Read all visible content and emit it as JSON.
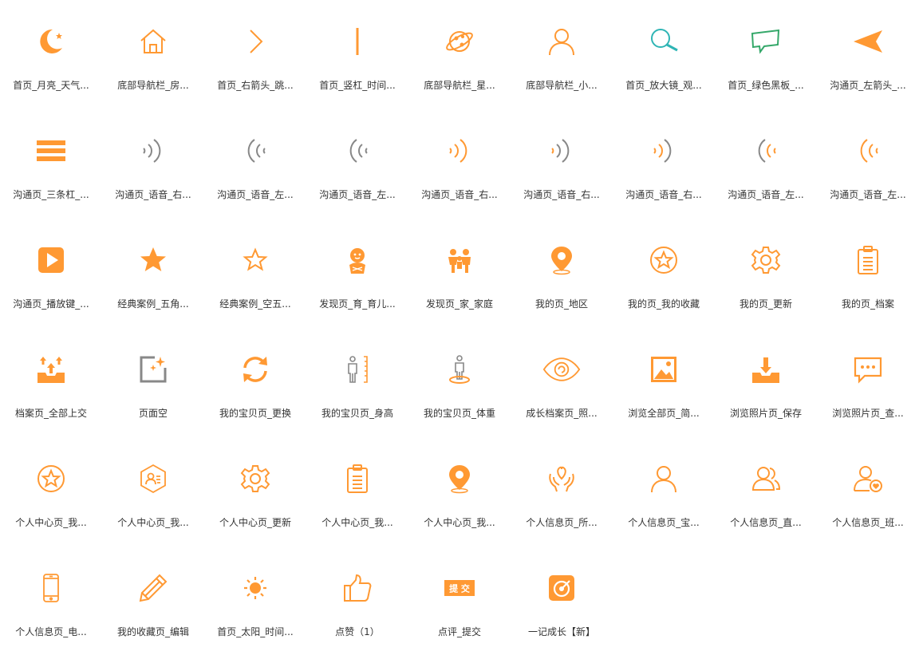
{
  "colors": {
    "orange": "#ff9933",
    "teal": "#2fb5b5",
    "green": "#35a86a",
    "gray": "#888888",
    "text": "#333333"
  },
  "icons": [
    {
      "label": "首页_月亮_天气...",
      "icon": "moon-icon"
    },
    {
      "label": "底部导航栏_房...",
      "icon": "house-icon"
    },
    {
      "label": "首页_右箭头_跳...",
      "icon": "chevron-right-icon"
    },
    {
      "label": "首页_竖杠_时间...",
      "icon": "vertical-bar-icon"
    },
    {
      "label": "底部导航栏_星...",
      "icon": "planet-icon"
    },
    {
      "label": "底部导航栏_小...",
      "icon": "person-outline-icon"
    },
    {
      "label": "首页_放大镜_观...",
      "icon": "magnifier-icon"
    },
    {
      "label": "首页_绿色黑板_...",
      "icon": "green-board-icon"
    },
    {
      "label": "沟通页_左箭头_...",
      "icon": "left-arrow-icon"
    },
    {
      "label": "沟通页_三条杠_...",
      "icon": "three-bars-icon"
    },
    {
      "label": "沟通页_语音_右...",
      "icon": "voice-right-gray-icon"
    },
    {
      "label": "沟通页_语音_左...",
      "icon": "voice-left-gray-icon"
    },
    {
      "label": "沟通页_语音_左...",
      "icon": "voice-left-gray-icon"
    },
    {
      "label": "沟通页_语音_右...",
      "icon": "voice-right-orange-icon"
    },
    {
      "label": "沟通页_语音_右...",
      "icon": "voice-right-mixed-icon"
    },
    {
      "label": "沟通页_语音_右...",
      "icon": "voice-right-mixed-icon"
    },
    {
      "label": "沟通页_语音_左...",
      "icon": "voice-left-mixed-icon"
    },
    {
      "label": "沟通页_语音_左...",
      "icon": "voice-left-orange-icon"
    },
    {
      "label": "沟通页_播放键_...",
      "icon": "play-button-icon"
    },
    {
      "label": "经典案例_五角...",
      "icon": "star-filled-icon"
    },
    {
      "label": "经典案例_空五...",
      "icon": "star-outline-icon"
    },
    {
      "label": "发现页_育_育儿...",
      "icon": "baby-icon"
    },
    {
      "label": "发现页_家_家庭",
      "icon": "family-icon"
    },
    {
      "label": "我的页_地区",
      "icon": "location-pin-icon"
    },
    {
      "label": "我的页_我的收藏",
      "icon": "star-circle-icon"
    },
    {
      "label": "我的页_更新",
      "icon": "gear-icon"
    },
    {
      "label": "我的页_档案",
      "icon": "clipboard-icon"
    },
    {
      "label": "档案页_全部上交",
      "icon": "upload-tray-icon"
    },
    {
      "label": "页面空",
      "icon": "empty-page-icon"
    },
    {
      "label": "我的宝贝页_更换",
      "icon": "refresh-icon"
    },
    {
      "label": "我的宝贝页_身高",
      "icon": "height-icon"
    },
    {
      "label": "我的宝贝页_体重",
      "icon": "weight-icon"
    },
    {
      "label": "成长档案页_照...",
      "icon": "eye-icon"
    },
    {
      "label": "浏览全部页_简...",
      "icon": "image-icon"
    },
    {
      "label": "浏览照片页_保存",
      "icon": "download-tray-icon"
    },
    {
      "label": "浏览照片页_查...",
      "icon": "chat-bubble-icon"
    },
    {
      "label": "个人中心页_我...",
      "icon": "star-circle-icon"
    },
    {
      "label": "个人中心页_我...",
      "icon": "hexagon-user-icon"
    },
    {
      "label": "个人中心页_更新",
      "icon": "gear-icon"
    },
    {
      "label": "个人中心页_我...",
      "icon": "clipboard-icon"
    },
    {
      "label": "个人中心页_我...",
      "icon": "location-pin-icon"
    },
    {
      "label": "个人信息页_所...",
      "icon": "hands-heart-icon"
    },
    {
      "label": "个人信息页_宝...",
      "icon": "person-outline-icon"
    },
    {
      "label": "个人信息页_直...",
      "icon": "two-persons-icon"
    },
    {
      "label": "个人信息页_班...",
      "icon": "person-heart-icon"
    },
    {
      "label": "个人信息页_电...",
      "icon": "phone-icon"
    },
    {
      "label": "我的收藏页_编辑",
      "icon": "pencil-icon"
    },
    {
      "label": "首页_太阳_时间...",
      "icon": "sun-icon"
    },
    {
      "label": "点赞（1）",
      "icon": "thumbs-up-icon"
    },
    {
      "label": "点评_提交",
      "icon": "submit-badge-icon",
      "badge_text": "提 交"
    },
    {
      "label": "一记成长【新】",
      "icon": "target-square-icon"
    }
  ]
}
